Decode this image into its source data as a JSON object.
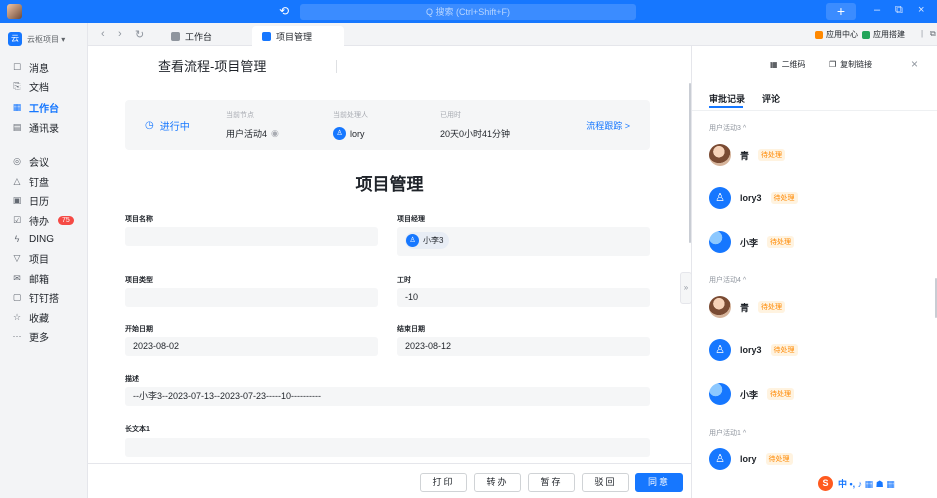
{
  "titlebar": {
    "history_icon": "history-icon",
    "search_placeholder": "Q 搜索 (Ctrl+Shift+F)",
    "plus": "+",
    "minimize": "–",
    "restore": "⧉",
    "close": "×"
  },
  "sidebar": {
    "org_name": "云枢项目 ▾",
    "org_logo": "云",
    "items": [
      {
        "label": "消息",
        "icon": "message-icon",
        "glyph": "☐"
      },
      {
        "label": "文档",
        "icon": "document-icon",
        "glyph": "⎘"
      },
      {
        "label": "工作台",
        "icon": "workbench-icon",
        "glyph": "▦",
        "active": true
      },
      {
        "label": "通讯录",
        "icon": "contacts-icon",
        "glyph": "▤"
      },
      {
        "label": "会议",
        "icon": "meeting-icon",
        "glyph": "◎"
      },
      {
        "label": "钉盘",
        "icon": "drive-icon",
        "glyph": "△"
      },
      {
        "label": "日历",
        "icon": "calendar-icon",
        "glyph": "▣"
      },
      {
        "label": "待办",
        "icon": "todo-icon",
        "glyph": "☑",
        "badge": "75"
      },
      {
        "label": "DING",
        "icon": "ding-icon",
        "glyph": "ϟ"
      },
      {
        "label": "项目",
        "icon": "project-icon",
        "glyph": "▽"
      },
      {
        "label": "邮箱",
        "icon": "mail-icon",
        "glyph": "✉"
      },
      {
        "label": "钉钉搭",
        "icon": "builder-icon",
        "glyph": "▢"
      },
      {
        "label": "收藏",
        "icon": "favorites-icon",
        "glyph": "☆"
      },
      {
        "label": "更多",
        "icon": "more-icon",
        "glyph": "···"
      }
    ]
  },
  "tabbar": {
    "back": "‹",
    "forward": "›",
    "refresh": "↻",
    "tabs": [
      {
        "label": "工作台",
        "color": "#8f959e"
      },
      {
        "label": "项目管理",
        "color": "#1677ff"
      }
    ],
    "app_center": "应用中心",
    "app_builder": "应用搭建",
    "app_center_color": "#ff8800",
    "app_builder_color": "#22a55a"
  },
  "main": {
    "page_title": "查看流程-项目管理",
    "status": {
      "running": "进行中",
      "running_icon": "clock-icon",
      "current_node_label": "当前节点",
      "current_node_value": "用户活动4",
      "handler_label": "当前处理人",
      "handler_value": "lory",
      "elapsed_label": "已用时",
      "elapsed_value": "20天0小时41分钟",
      "track": "流程跟踪 >"
    },
    "form_title": "项目管理",
    "fields": {
      "project_name_label": "项目名称",
      "project_name_value": "",
      "manager_label": "项目经理",
      "manager_value": "小李3",
      "project_type_label": "项目类型",
      "project_type_value": "",
      "hours_label": "工时",
      "hours_value": "-10",
      "start_label": "开始日期",
      "start_value": "2023-08-02",
      "end_label": "结束日期",
      "end_value": "2023-08-12",
      "desc_label": "描述",
      "desc_value": "--小李3--2023-07-13--2023-07-23-----10----------",
      "long_text_label": "长文本1",
      "long_text_value": ""
    },
    "actions": {
      "print": "打印",
      "transfer": "转办",
      "save": "暂存",
      "reject": "驳回",
      "approve": "同意"
    }
  },
  "rpanel": {
    "qrcode": "二维码",
    "copy_link": "复制链接",
    "close": "×",
    "tabs": {
      "records": "审批记录",
      "comments": "评论"
    },
    "groups": [
      {
        "title": "用户活动3 ^",
        "entries": [
          {
            "name": "青",
            "status": "待处理",
            "avatar": "photo"
          },
          {
            "name": "lory3",
            "status": "待处理",
            "avatar": "blue"
          },
          {
            "name": "小李",
            "status": "待处理",
            "avatar": "globe"
          }
        ]
      },
      {
        "title": "用户活动4 ^",
        "entries": [
          {
            "name": "青",
            "status": "待处理",
            "avatar": "photo"
          },
          {
            "name": "lory3",
            "status": "待处理",
            "avatar": "blue"
          },
          {
            "name": "小李",
            "status": "待处理",
            "avatar": "globe"
          }
        ]
      },
      {
        "title": "用户活动1 ^",
        "entries": [
          {
            "name": "lory",
            "status": "待处理",
            "avatar": "blue"
          }
        ]
      }
    ],
    "collapse_handle": "»",
    "ime": {
      "logo": "S",
      "text": "中 •, ♪ ▦ ☗ ▦"
    }
  }
}
